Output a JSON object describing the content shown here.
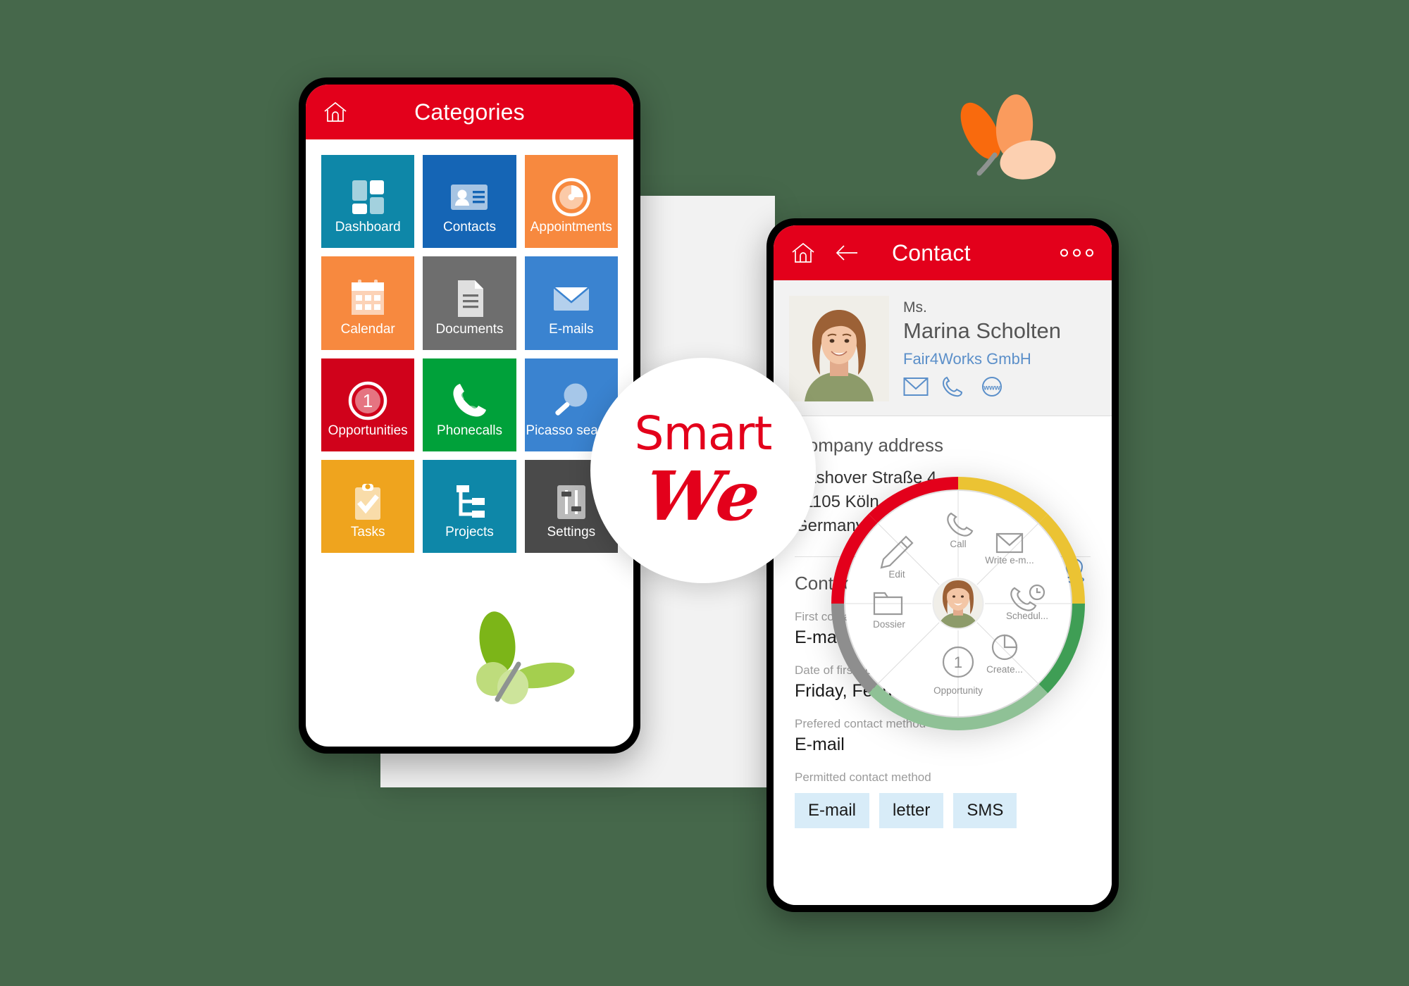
{
  "brand": {
    "logo_line1": "Smart",
    "logo_line2": "We",
    "accent_red": "#e3001b",
    "link_blue": "#5b8fc9"
  },
  "left_phone": {
    "appbar": {
      "home_icon": "home-icon",
      "title": "Categories"
    },
    "tiles": [
      {
        "label": "Dashboard",
        "icon": "dashboard-icon",
        "color": "#0e87a8"
      },
      {
        "label": "Contacts",
        "icon": "contact-card-icon",
        "color": "#1565b5"
      },
      {
        "label": "Appointments",
        "icon": "clock-pie-icon",
        "color": "#f7893f"
      },
      {
        "label": "Calendar",
        "icon": "calendar-icon",
        "color": "#f7893f"
      },
      {
        "label": "Documents",
        "icon": "document-icon",
        "color": "#6e6e6e"
      },
      {
        "label": "E-mails",
        "icon": "envelope-icon",
        "color": "#3a83d0"
      },
      {
        "label": "Opportunities",
        "icon": "opportunity-icon",
        "color": "#d0021b",
        "badge": "1"
      },
      {
        "label": "Phonecalls",
        "icon": "phone-icon",
        "color": "#00a13a"
      },
      {
        "label": "Picasso search",
        "icon": "magnifier-icon",
        "color": "#3a83d0"
      },
      {
        "label": "Tasks",
        "icon": "clipboard-check-icon",
        "color": "#efa41e"
      },
      {
        "label": "Projects",
        "icon": "project-tree-icon",
        "color": "#0e87a8"
      },
      {
        "label": "Settings",
        "icon": "sliders-icon",
        "color": "#4a4a4a"
      }
    ]
  },
  "right_phone": {
    "appbar": {
      "home_icon": "home-icon",
      "back_icon": "back-arrow-icon",
      "title": "Contact",
      "overflow_icon": "more-options-icon"
    },
    "contact": {
      "salutation": "Ms.",
      "name": "Marina Scholten",
      "company": "Fair4Works GmbH",
      "quick_actions": [
        "email-icon",
        "phone-icon",
        "www-icon"
      ]
    },
    "address_section": {
      "title": "Company address",
      "lines": [
        "Nashover Straße 4",
        "51105 Köln",
        "Germany"
      ],
      "map_pin_icon": "location-pin-icon"
    },
    "details_section": {
      "title": "Contact",
      "fields": [
        {
          "label": "First contact via",
          "value": "E-mail"
        },
        {
          "label": "Date of first contact",
          "value": "Friday, Febuary 3, 2017"
        },
        {
          "label": "Prefered contact method",
          "value": "E-mail"
        }
      ],
      "permitted_label": "Permitted contact method",
      "permitted_chips": [
        "E-mail",
        "letter",
        "SMS"
      ]
    }
  },
  "radial_menu": {
    "center_avatar": "contact-avatar",
    "segments": [
      {
        "label": "Call",
        "icon": "phone-icon",
        "ring_color": "#ebc333"
      },
      {
        "label": "Write e-m...",
        "icon": "envelope-icon",
        "ring_color": "#ebc333"
      },
      {
        "label": "Schedul...",
        "icon": "phone-clock-icon",
        "ring_color": "#3f9e55"
      },
      {
        "label": "Create...",
        "icon": "pie-chart-icon",
        "ring_color": "#3f9e55"
      },
      {
        "label": "Opportunity",
        "icon": "badge-one-icon",
        "ring_color": "#8fc196",
        "badge": "1"
      },
      {
        "label": "Dossier",
        "icon": "folder-icon",
        "ring_color": "#8e8e8e"
      },
      {
        "label": "Edit",
        "icon": "pencil-icon",
        "ring_color": "#e3001b"
      }
    ]
  },
  "decorations": {
    "butterfly_green": "butterfly-green-icon",
    "butterfly_orange": "butterfly-orange-icon"
  }
}
